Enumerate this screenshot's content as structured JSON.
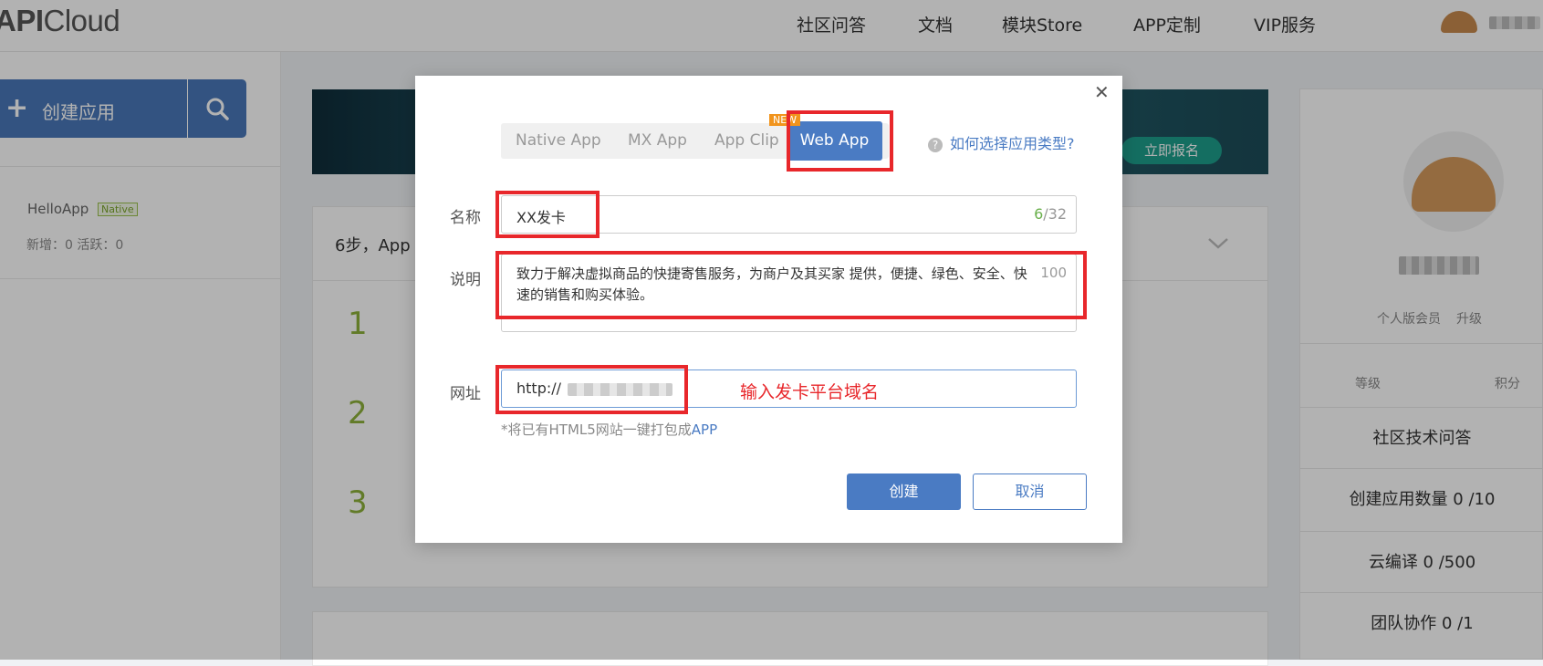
{
  "header": {
    "logo_bold": "API",
    "logo_rest": "Cloud",
    "nav": [
      "社区问答",
      "文档",
      "模块Store",
      "APP定制",
      "VIP服务"
    ]
  },
  "sidebar": {
    "create_label": "创建应用",
    "app_name": "HelloApp",
    "app_tag": "Native",
    "app_stats": "新增：0   活跃：0"
  },
  "banner": {
    "cta": "立即报名"
  },
  "steps": {
    "heading": "6步，App"
  },
  "right_panel": {
    "member_label": "个人版会员",
    "upgrade_label": "升级",
    "level_label": "等级",
    "points_label": "积分",
    "rows": [
      "社区技术问答",
      "创建应用数量 0 /10",
      "云编译 0 /500",
      "团队协作 0 /1"
    ]
  },
  "modal": {
    "tabs": [
      "Native App",
      "MX App",
      "App Clip",
      "Web App"
    ],
    "active_tab": "Web App",
    "new_badge": "NEW",
    "help_text": "如何选择应用类型?",
    "name_label": "名称",
    "name_value": "XX发卡",
    "name_count": "6",
    "name_max": "/32",
    "desc_label": "说明",
    "desc_value": "致力于解决虚拟商品的快捷寄售服务，为商户及其买家 提供，便捷、绿色、安全、快速的销售和购买体验。",
    "desc_max": "100",
    "url_label": "网址",
    "url_value": "http://",
    "annotation": "输入发卡平台域名",
    "hint_prefix": "*将已有HTML5网站一键打包成",
    "hint_app": "APP",
    "confirm_label": "创建",
    "cancel_label": "取消"
  },
  "colors": {
    "accent": "#4a7bc3",
    "highlight": "#e8272b",
    "green": "#8db13a"
  }
}
